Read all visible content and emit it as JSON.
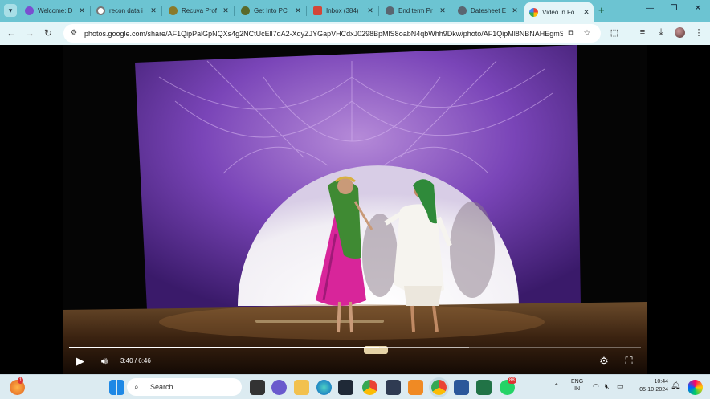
{
  "browser": {
    "tabs": [
      {
        "title": "Welcome: D",
        "color": "#7a4fd0"
      },
      {
        "title": "recon data i",
        "color": "#888888"
      },
      {
        "title": "Recuva Prof",
        "color": "#8a7a2a"
      },
      {
        "title": "Get Into PC",
        "color": "#5a6a2a"
      },
      {
        "title": "Inbox (384)",
        "color": "#d44638"
      },
      {
        "title": "End term Pr",
        "color": "#5a6570"
      },
      {
        "title": "Datesheet E",
        "color": "#5a6570"
      },
      {
        "title": "Video in Fo",
        "color": "#fbbc05"
      }
    ],
    "url": "photos.google.com/share/AF1QipPalGpNQXs4g2NCtUcEll7dA2-XqyZJYGapVHCdxJ0298BpMlS8oabN4qbWhh9Dkw/photo/AF1QipMl8NBNAHEgmS..."
  },
  "video": {
    "current_time": "3:40",
    "duration": "6:46",
    "time_text": "3:40 / 6:46",
    "progress": 0.5419
  },
  "taskbar": {
    "search_placeholder": "Search",
    "notification_count": "1",
    "whatsapp_badge": "88",
    "language_line1": "ENG",
    "language_line2": "IN",
    "time": "10:44",
    "date": "05-10-2024"
  }
}
